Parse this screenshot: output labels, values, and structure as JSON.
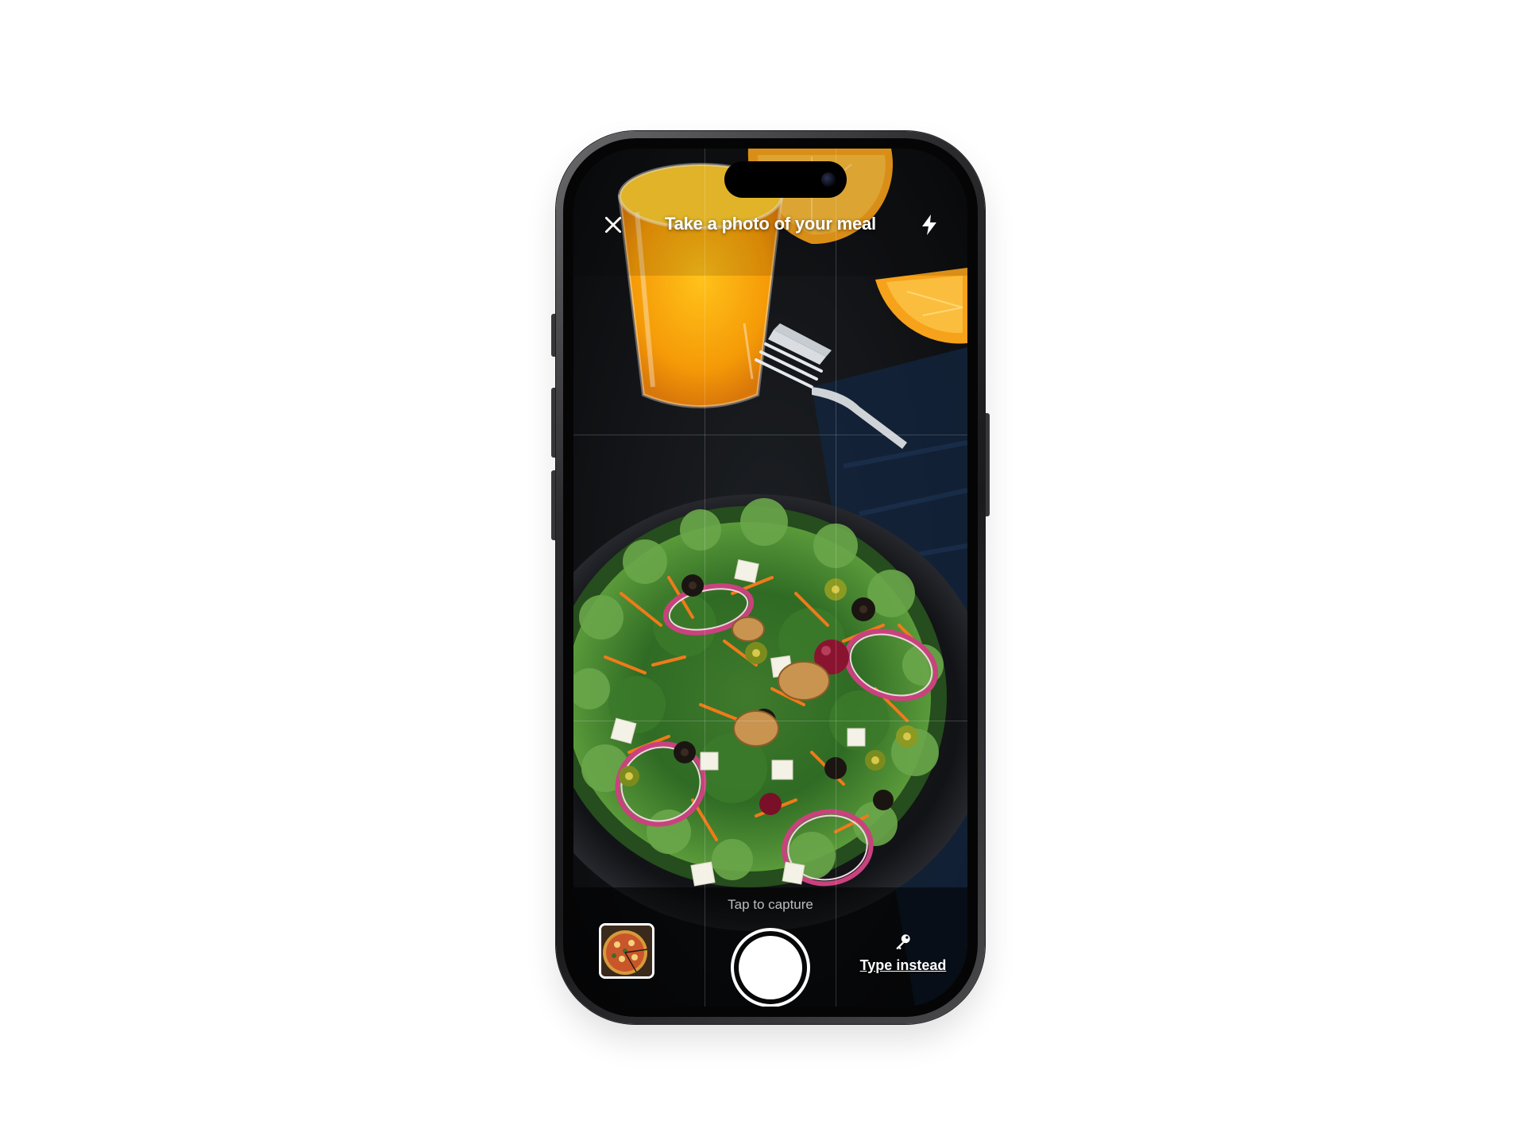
{
  "camera_screen": {
    "title": "Take a photo of your meal",
    "hint": "Tap to capture",
    "type_instead_label": "Type instead"
  },
  "icons": {
    "close": "close-icon",
    "flash": "flash-icon",
    "key": "key-icon",
    "gallery_thumbnail": "pizza-thumbnail",
    "shutter": "shutter-button"
  },
  "colors": {
    "overlay_text": "#ffffff",
    "hint_text": "#bfbfbf"
  }
}
